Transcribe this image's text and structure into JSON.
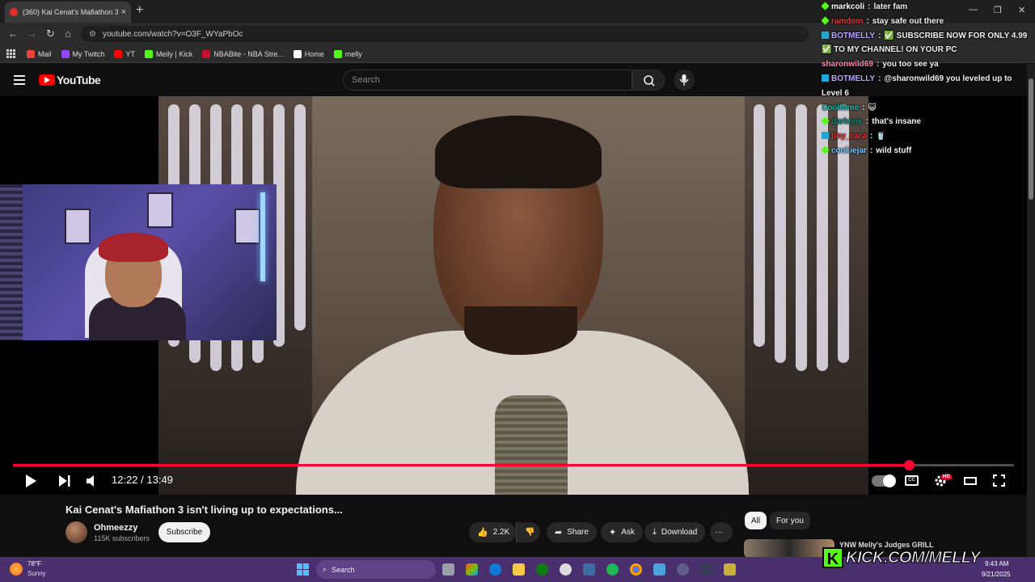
{
  "browser": {
    "tab_title": "(360) Kai Cenat's Mafiathon 3 i",
    "tab_close": "×",
    "new_tab": "+",
    "url": "youtube.com/watch?v=O3F_WYaPbOc",
    "nav": {
      "back": "←",
      "forward": "→",
      "reload": "↻",
      "home": "⌂"
    },
    "window": {
      "minimize": "—",
      "restore": "❐",
      "close": "✕"
    },
    "bookmarks": [
      {
        "label": "Mail",
        "color": "#ea4335"
      },
      {
        "label": "My Twitch",
        "color": "#9146ff"
      },
      {
        "label": "YT",
        "color": "#ff0000"
      },
      {
        "label": "Melly | Kick",
        "color": "#53fc18"
      },
      {
        "label": "NBABite - NBA Stre...",
        "color": "#c8102e"
      },
      {
        "label": "Home",
        "color": "#ffffff"
      },
      {
        "label": "melly",
        "color": "#53fc18"
      }
    ]
  },
  "youtube": {
    "logo_text": "YouTube",
    "search_placeholder": "Search",
    "player": {
      "current_time": "12:22",
      "duration": "13:49",
      "timecode": "12:22 / 13:49",
      "progress": 0.895,
      "hd_badge": "HD",
      "cc_label": "CC"
    },
    "video": {
      "title": "Kai Cenat's Mafiathon 3 isn't living up to expectations...",
      "channel": "Ohmeezzy",
      "subscribers": "115K subscribers",
      "subscribe_label": "Subscribe",
      "likes": "2.2K",
      "share_label": "Share",
      "ask_label": "Ask",
      "download_label": "Download",
      "more_label": "···"
    },
    "chips": [
      "All",
      "For you"
    ],
    "recommended": {
      "title": "YNW Melly's Judges GRILL"
    }
  },
  "chat": [
    {
      "user": "markcoli",
      "color": "#ffffff",
      "msg": "later fam",
      "badge": "diamond"
    },
    {
      "user": "ramdom",
      "color": "#e03a3a",
      "msg": "stay safe out there",
      "badge": "diamond"
    },
    {
      "user": "BOTMELLY",
      "color": "#b9a4ff",
      "msg": "✅ SUBSCRIBE NOW FOR ONLY 4.99",
      "badge": "bot"
    },
    {
      "user": "",
      "color": "#ffffff",
      "msg": "✅ TO MY CHANNEL! ON YOUR PC",
      "badge": ""
    },
    {
      "user": "sharonwild69",
      "color": "#ff8ab0",
      "msg": "you too see ya",
      "badge": ""
    },
    {
      "user": "BOTMELLY",
      "color": "#b9a4ff",
      "msg": "@sharonwild69 you leveled up to",
      "badge": "bot"
    },
    {
      "user": "",
      "color": "#ffffff",
      "msg": "Level 6",
      "badge": ""
    },
    {
      "user": "Coolfome",
      "color": "#00c2b2",
      "msg": "😺",
      "badge": ""
    },
    {
      "user": "darkone",
      "color": "#1e8a7a",
      "msg": "that's insane",
      "badge": "diamond"
    },
    {
      "user": "tiny_cara",
      "color": "#e03a3a",
      "msg": "🥤",
      "badge": "bot"
    },
    {
      "user": "cookiejar",
      "color": "#7ec8ff",
      "msg": "wild stuff",
      "badge": "diamond"
    }
  ],
  "chat_sep": ":",
  "taskbar": {
    "temp": "78°F",
    "condition": "Sunny",
    "search_label": "Search",
    "time": "9:43 AM",
    "date": "9/21/2025"
  },
  "watermark": {
    "k": "K",
    "text": "KICK.COM/MELLY"
  },
  "colors": {
    "yt_red": "#ff0033",
    "kick_green": "#53fc18",
    "taskbar": "#4a2f6e"
  }
}
